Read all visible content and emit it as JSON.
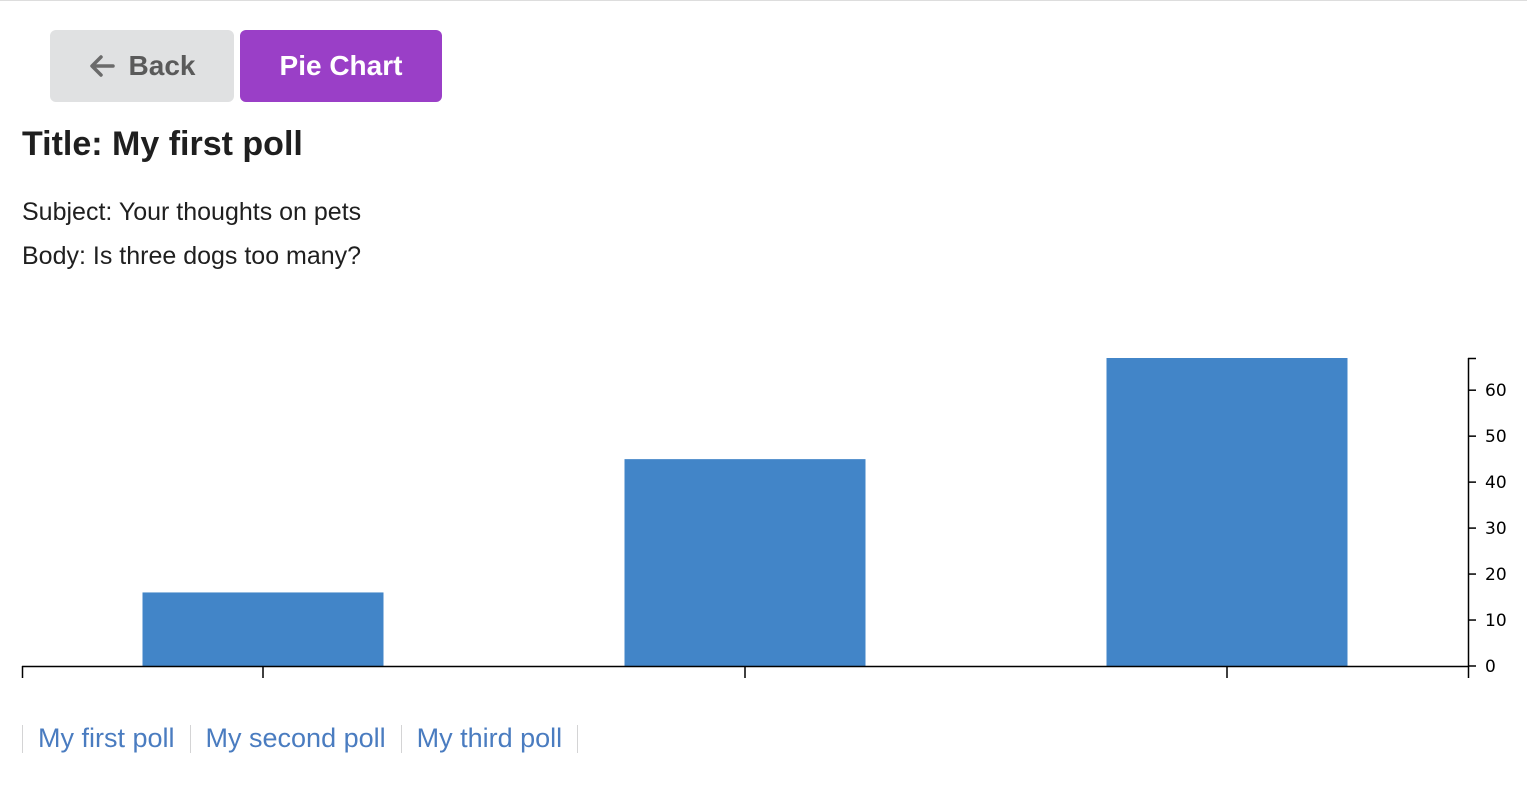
{
  "toolbar": {
    "back_label": "Back",
    "pie_chart_label": "Pie Chart",
    "back_icon": "arrow-left-icon"
  },
  "poll": {
    "title": "Title: My first poll",
    "subject": "Subject: Your thoughts on pets",
    "body": "Body: Is three dogs too many?"
  },
  "chart_data": {
    "type": "bar",
    "categories": [
      "",
      "",
      ""
    ],
    "values": [
      16,
      45,
      67
    ],
    "title": "",
    "xlabel": "",
    "ylabel": "",
    "ylim": [
      0,
      67
    ],
    "yticks": [
      0,
      10,
      20,
      30,
      40,
      50,
      60
    ],
    "y_axis_side": "right",
    "grid": false,
    "bar_color": "#4285c8"
  },
  "poll_links": [
    {
      "label": "My first poll"
    },
    {
      "label": "My second poll"
    },
    {
      "label": "My third poll"
    }
  ],
  "colors": {
    "primary": "#9a3fc7",
    "link": "#4a7cc0",
    "back_button_bg": "#e0e1e2"
  }
}
